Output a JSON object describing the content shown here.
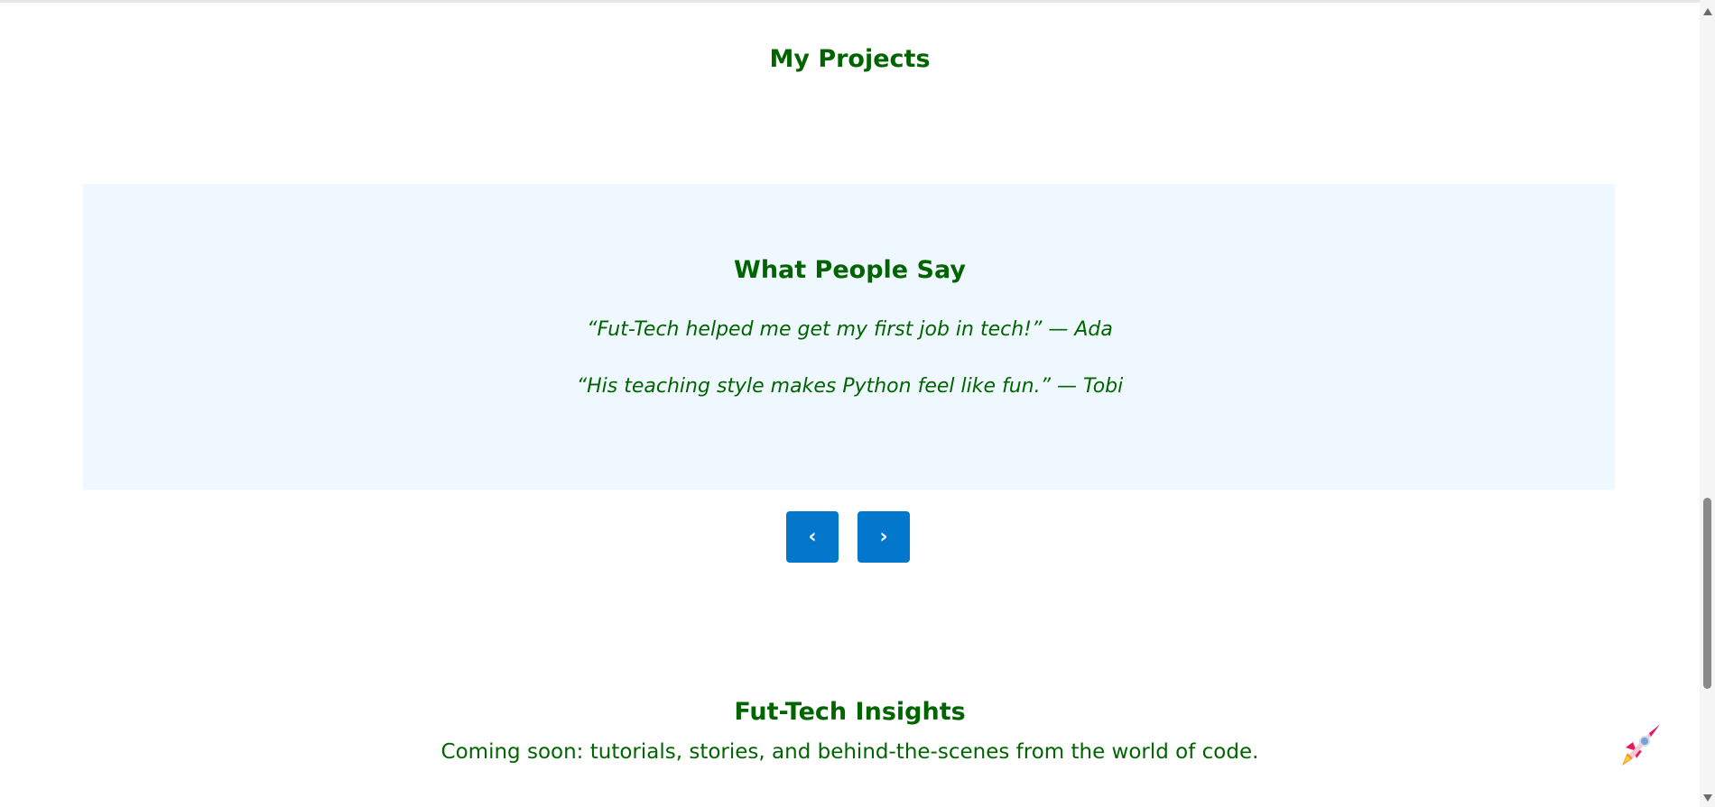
{
  "sections": {
    "projects_title": "My Projects",
    "testimonials_title": "What People Say",
    "testimonials": [
      "“Fut-Tech helped me get my first job in tech!” — Ada",
      "“His teaching style makes Python feel like fun.” — Tobi"
    ],
    "insights_title": "Fut-Tech Insights",
    "insights_text": "Coming soon: tutorials, stories, and behind-the-scenes from the world of code."
  },
  "carousel": {
    "prev_label": "‹",
    "next_label": "›"
  },
  "icons": {
    "floating_button": "rocket-icon",
    "scroll_up": "triangle-up-icon",
    "scroll_down": "triangle-down-icon"
  },
  "colors": {
    "heading": "#006400",
    "testimonial_bg": "#f0f8ff",
    "button_bg": "#0277cc"
  }
}
